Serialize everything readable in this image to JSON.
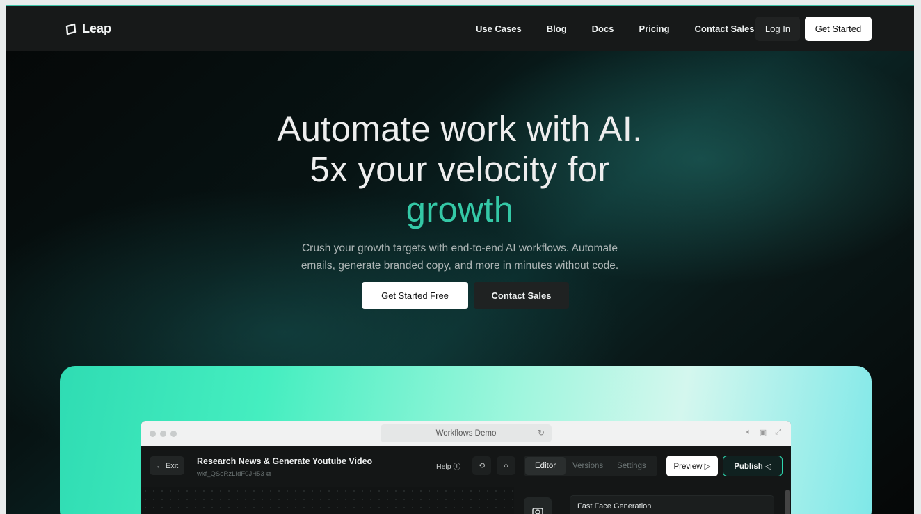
{
  "nav": {
    "logo_text": "Leap",
    "links": [
      "Use Cases",
      "Blog",
      "Docs",
      "Pricing",
      "Contact Sales"
    ],
    "login_label": "Log In",
    "get_started_label": "Get Started"
  },
  "hero": {
    "title_line1": "Automate work with AI.",
    "title_line2": "5x your velocity for",
    "title_accent": "growth",
    "subtitle_line1": "Crush your growth targets with end-to-end AI workflows. Automate",
    "subtitle_line2": "emails, generate branded copy, and more in minutes without code.",
    "primary_cta": "Get Started Free",
    "secondary_cta": "Contact Sales",
    "accent_color": "#34c8a6"
  },
  "demo": {
    "window_title": "Workflows Demo",
    "exit_label": "← Exit",
    "workflow_title": "Research News & Generate Youtube Video",
    "workflow_id": "wkf_QSeRzLIdF0JH53",
    "help_label": "Help ⓘ",
    "tabs": [
      "Editor",
      "Versions",
      "Settings"
    ],
    "preview_label": "Preview ▷",
    "publish_label": "Publish ◁",
    "node_title": "Fast Face Generation"
  }
}
